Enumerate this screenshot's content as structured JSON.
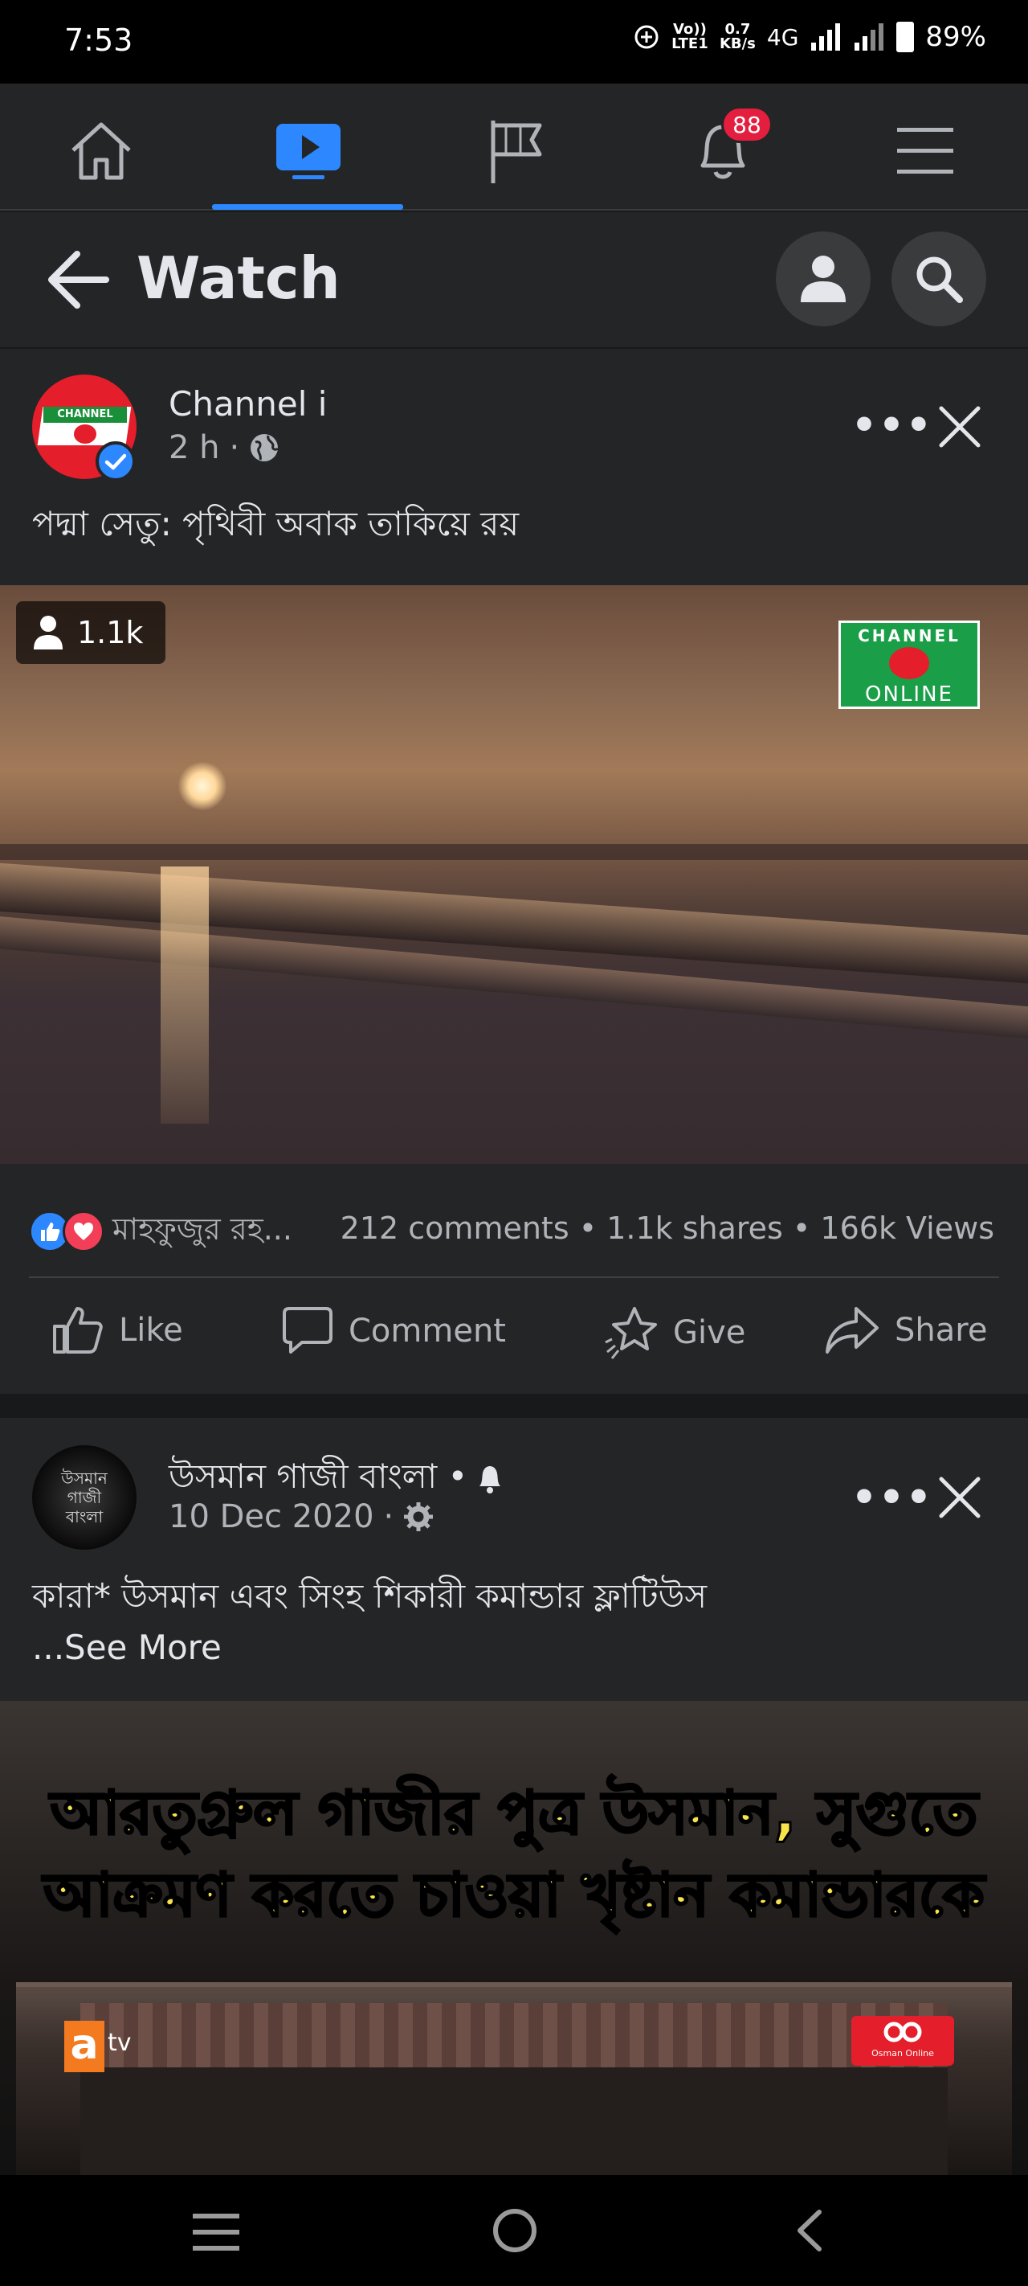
{
  "status": {
    "time": "7:53",
    "volte": "Vo)) LTE1",
    "speed_value": "0.7",
    "speed_unit": "KB/s",
    "network": "4G",
    "battery": "89%"
  },
  "nav": {
    "notifications_count": "88",
    "active_tab": "watch"
  },
  "watch": {
    "title": "Watch"
  },
  "post1": {
    "author": "Channel i",
    "avatar_text": "CHANNEL",
    "time": "2 h",
    "privacy_icon": "globe-icon",
    "caption": "পদ্মা সেতু: পৃথিবী অবাক তাকিয়ে রয়",
    "viewers": "1.1k",
    "watermark_top": "CHANNEL",
    "watermark_bottom": "ONLINE",
    "reactors": "মাহফুজুর রহ...",
    "stats": "212 comments • 1.1k shares • 166k Views",
    "actions": {
      "like": "Like",
      "comment": "Comment",
      "give": "Give",
      "share": "Share"
    }
  },
  "post2": {
    "author": "উসমান গাজী বাংলা •",
    "avatar_text": "উসমান গাজী বাংলা",
    "time": "10 Dec 2020",
    "caption": "কারা* উসমান এবং সিংহ শিকারী কমান্ডার ফ্লাটিউস",
    "see_more": "...See More",
    "video_title_line1": "আরতুগ্রুল গাজীর পুত্র উসমান, সুগুতে",
    "video_title_line2": "আক্রমণ করতে চাওয়া খৃষ্টান কমান্ডারকে ...",
    "logo_left": "a",
    "logo_left_suffix": "tv",
    "logo_right": "Osman Online"
  }
}
